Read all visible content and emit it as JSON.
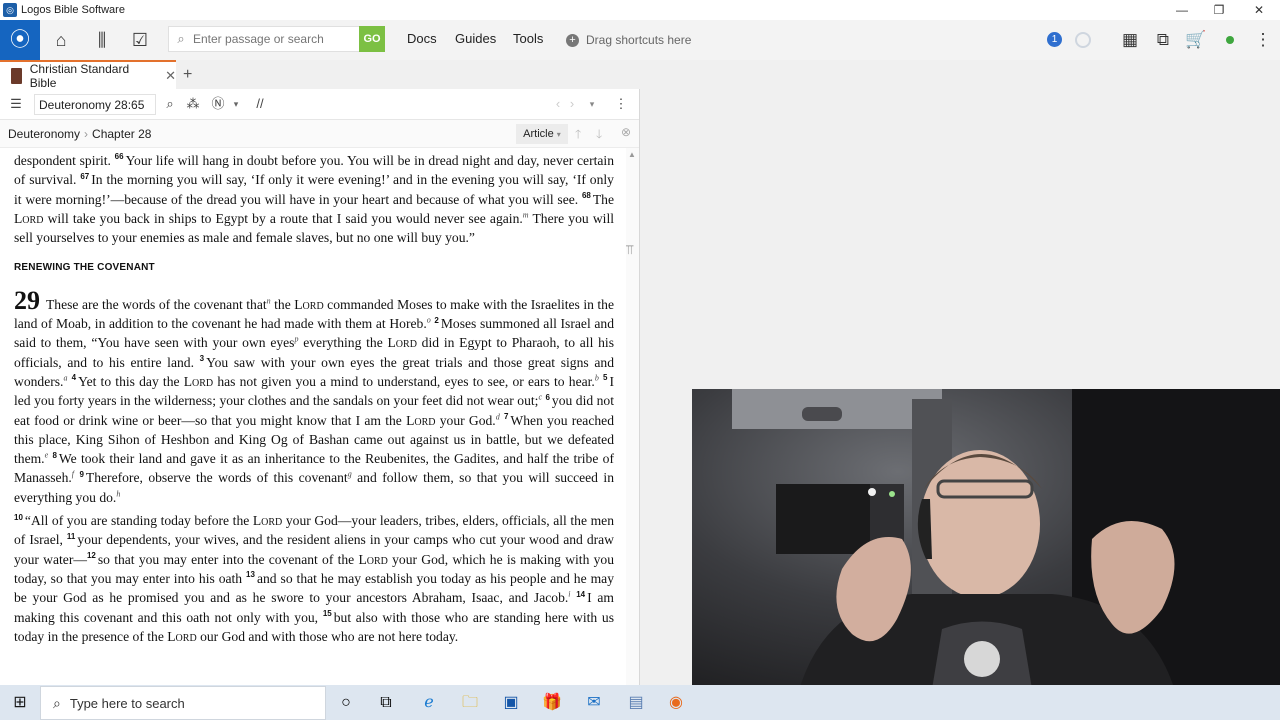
{
  "window": {
    "title": "Logos Bible Software"
  },
  "toolbar": {
    "search_placeholder": "Enter passage or search",
    "go_label": "GO",
    "menu": [
      "Docs",
      "Guides",
      "Tools"
    ],
    "shortcuts_label": "Drag shortcuts here",
    "notification_count": "1"
  },
  "tabs": [
    {
      "label": "Christian Standard Bible"
    }
  ],
  "panel": {
    "reference": "Deuteronomy 28:65",
    "breadcrumb": [
      "Deuteronomy",
      "Chapter 28"
    ],
    "view_mode": "Article"
  },
  "text": {
    "p1": [
      {
        "t": "despondent spirit. "
      },
      {
        "v": "66"
      },
      {
        "t": "Your life will hang in doubt before you. You will be in dread night and day, never certain of survival. "
      },
      {
        "v": "67"
      },
      {
        "t": "In the morning you will say, ‘If only it were evening!’ and in the evening you will say, ‘If only it were morning!’—because of the dread you will have in your heart and because of what you will see. "
      },
      {
        "v": "68"
      },
      {
        "t": "The "
      },
      {
        "sc": "Lord"
      },
      {
        "t": " will take you back in ships to Egypt by a route that I said you would never see again."
      },
      {
        "f": "m"
      },
      {
        "t": " There you will sell yourselves to your enemies as male and female slaves, but no one will buy you.”"
      }
    ],
    "heading": "RENEWING THE COVENANT",
    "chapter": "29",
    "p2": [
      {
        "t": "These are the words of the covenant that"
      },
      {
        "f": "n"
      },
      {
        "t": " the "
      },
      {
        "sc": "Lord"
      },
      {
        "t": " commanded Moses to make with the Israelites in the land of Moab, in addition to the covenant he had made with them at Horeb."
      },
      {
        "f": "o"
      },
      {
        "t": " "
      },
      {
        "v": "2"
      },
      {
        "t": "Moses summoned all Israel and said to them, “You have seen with your own eyes"
      },
      {
        "f": "p"
      },
      {
        "t": " everything the "
      },
      {
        "sc": "Lord"
      },
      {
        "t": " did in Egypt to Pharaoh, to all his officials, and to his entire land. "
      },
      {
        "v": "3"
      },
      {
        "t": "You saw with your own eyes the great trials and those great signs and wonders."
      },
      {
        "f": "a"
      },
      {
        "t": " "
      },
      {
        "v": "4"
      },
      {
        "t": "Yet to this day the "
      },
      {
        "sc": "Lord"
      },
      {
        "t": " has not given you a mind to understand, eyes to see, or ears to hear."
      },
      {
        "f": "b"
      },
      {
        "t": " "
      },
      {
        "v": "5"
      },
      {
        "t": "I led you forty years in the wilderness; your clothes and the sandals on your feet did not wear out;"
      },
      {
        "f": "c"
      },
      {
        "t": " "
      },
      {
        "v": "6"
      },
      {
        "t": "you did not eat food or drink wine or beer—so that you might know that I am the "
      },
      {
        "sc": "Lord"
      },
      {
        "t": " your God."
      },
      {
        "f": "d"
      },
      {
        "t": " "
      },
      {
        "v": "7"
      },
      {
        "t": "When you reached this place, King Sihon of Heshbon and King Og of Bashan came out against us in battle, but we defeated them."
      },
      {
        "f": "e"
      },
      {
        "t": " "
      },
      {
        "v": "8"
      },
      {
        "t": "We took their land and gave it as an inheritance to the Reubenites, the Gadites, and half the tribe of Manasseh."
      },
      {
        "f": "f"
      },
      {
        "t": " "
      },
      {
        "v": "9"
      },
      {
        "t": "Therefore, observe the words of this covenant"
      },
      {
        "f": "g"
      },
      {
        "t": " and follow them, so that you will succeed in everything you do."
      },
      {
        "f": "h"
      }
    ],
    "p3": [
      {
        "v": "10"
      },
      {
        "t": "“All of you are standing today before the "
      },
      {
        "sc": "Lord"
      },
      {
        "t": " your God—your leaders, tribes, elders, officials, all the men of Israel, "
      },
      {
        "v": "11"
      },
      {
        "t": "your dependents, your wives, and the resident aliens in your camps who cut your wood and draw your water—"
      },
      {
        "v": "12"
      },
      {
        "t": "so that you may enter into the covenant of the "
      },
      {
        "sc": "Lord"
      },
      {
        "t": " your God, which he is making with you today, so that you may enter into his oath "
      },
      {
        "v": "13"
      },
      {
        "t": "and so that he may establish you today as his people and he may be your God as he promised you and as he swore to your ancestors Abraham, Isaac, and Jacob."
      },
      {
        "f": "i"
      },
      {
        "t": " "
      },
      {
        "v": "14"
      },
      {
        "t": "I am making this covenant and this oath not only with you, "
      },
      {
        "v": "15"
      },
      {
        "t": "but also with those who are standing here with us today in the presence of the "
      },
      {
        "sc": "Lord"
      },
      {
        "t": " our God and with those who are not here today."
      }
    ]
  },
  "taskbar": {
    "search_placeholder": "Type here to search"
  },
  "colors": {
    "accent_blue": "#1565c0",
    "go_green": "#7cc043",
    "tab_accent": "#e3712d",
    "status_green": "#3ea63e"
  }
}
